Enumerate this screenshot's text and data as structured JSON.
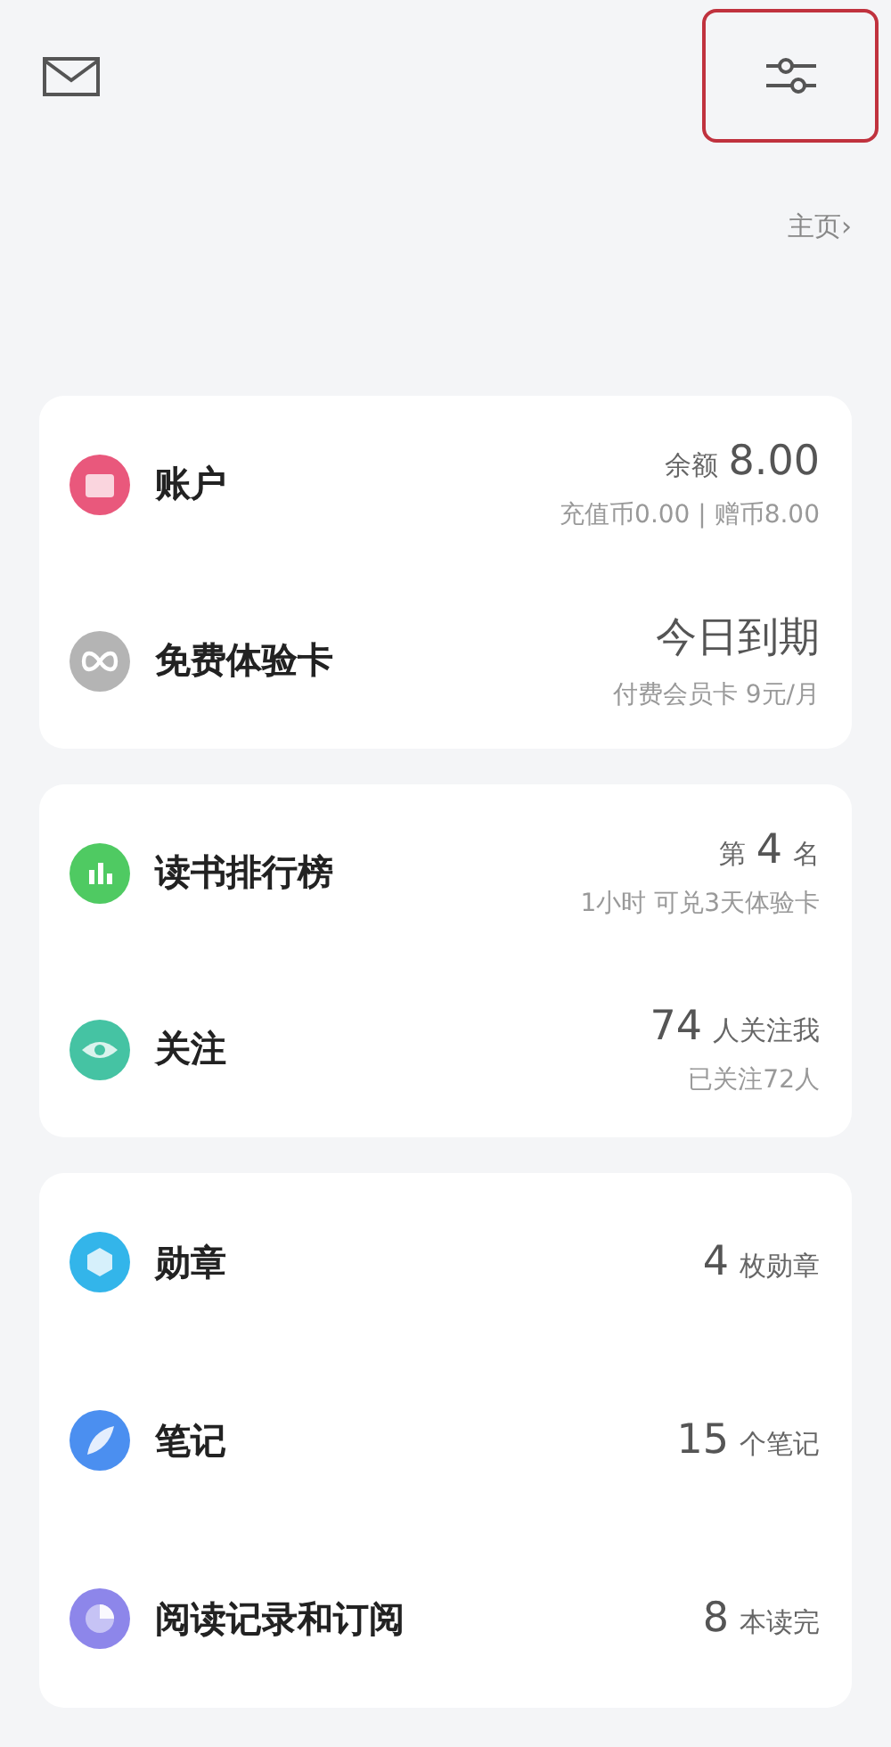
{
  "header": {
    "settings_button": {
      "highlighted": true
    },
    "home_link": {
      "label": "主页",
      "chevron": "›"
    }
  },
  "cards": [
    {
      "rows": [
        {
          "kind": "wallet",
          "color": "#e9587c",
          "label": "账户",
          "value": {
            "before": "余额",
            "main": "8.00"
          },
          "sub": "充值币0.00 | 赠币8.00"
        },
        {
          "kind": "infinity",
          "color": "#b4b4b4",
          "label": "免费体验卡",
          "value": {
            "main": "今日到期"
          },
          "sub": "付费会员卡 9元/月"
        }
      ]
    },
    {
      "rows": [
        {
          "kind": "chart",
          "color": "#4fca62",
          "label": "读书排行榜",
          "value": {
            "before": "第",
            "main": "4",
            "after": "名"
          },
          "sub": "1小时 可兑3天体验卡"
        },
        {
          "kind": "eye",
          "color": "#45c3a3",
          "label": "关注",
          "value": {
            "main": "74",
            "after": "人关注我"
          },
          "sub": "已关注72人"
        }
      ]
    },
    {
      "rows": [
        {
          "kind": "badge",
          "color": "#33b5ea",
          "label": "勋章",
          "value": {
            "main": "4",
            "after": "枚勋章"
          }
        },
        {
          "kind": "feather",
          "color": "#4b8ff0",
          "label": "笔记",
          "value": {
            "main": "15",
            "after": "个笔记"
          }
        },
        {
          "kind": "clock",
          "color": "#8d86ea",
          "label": "阅读记录和订阅",
          "value": {
            "main": "8",
            "after": "本读完"
          }
        }
      ]
    }
  ]
}
